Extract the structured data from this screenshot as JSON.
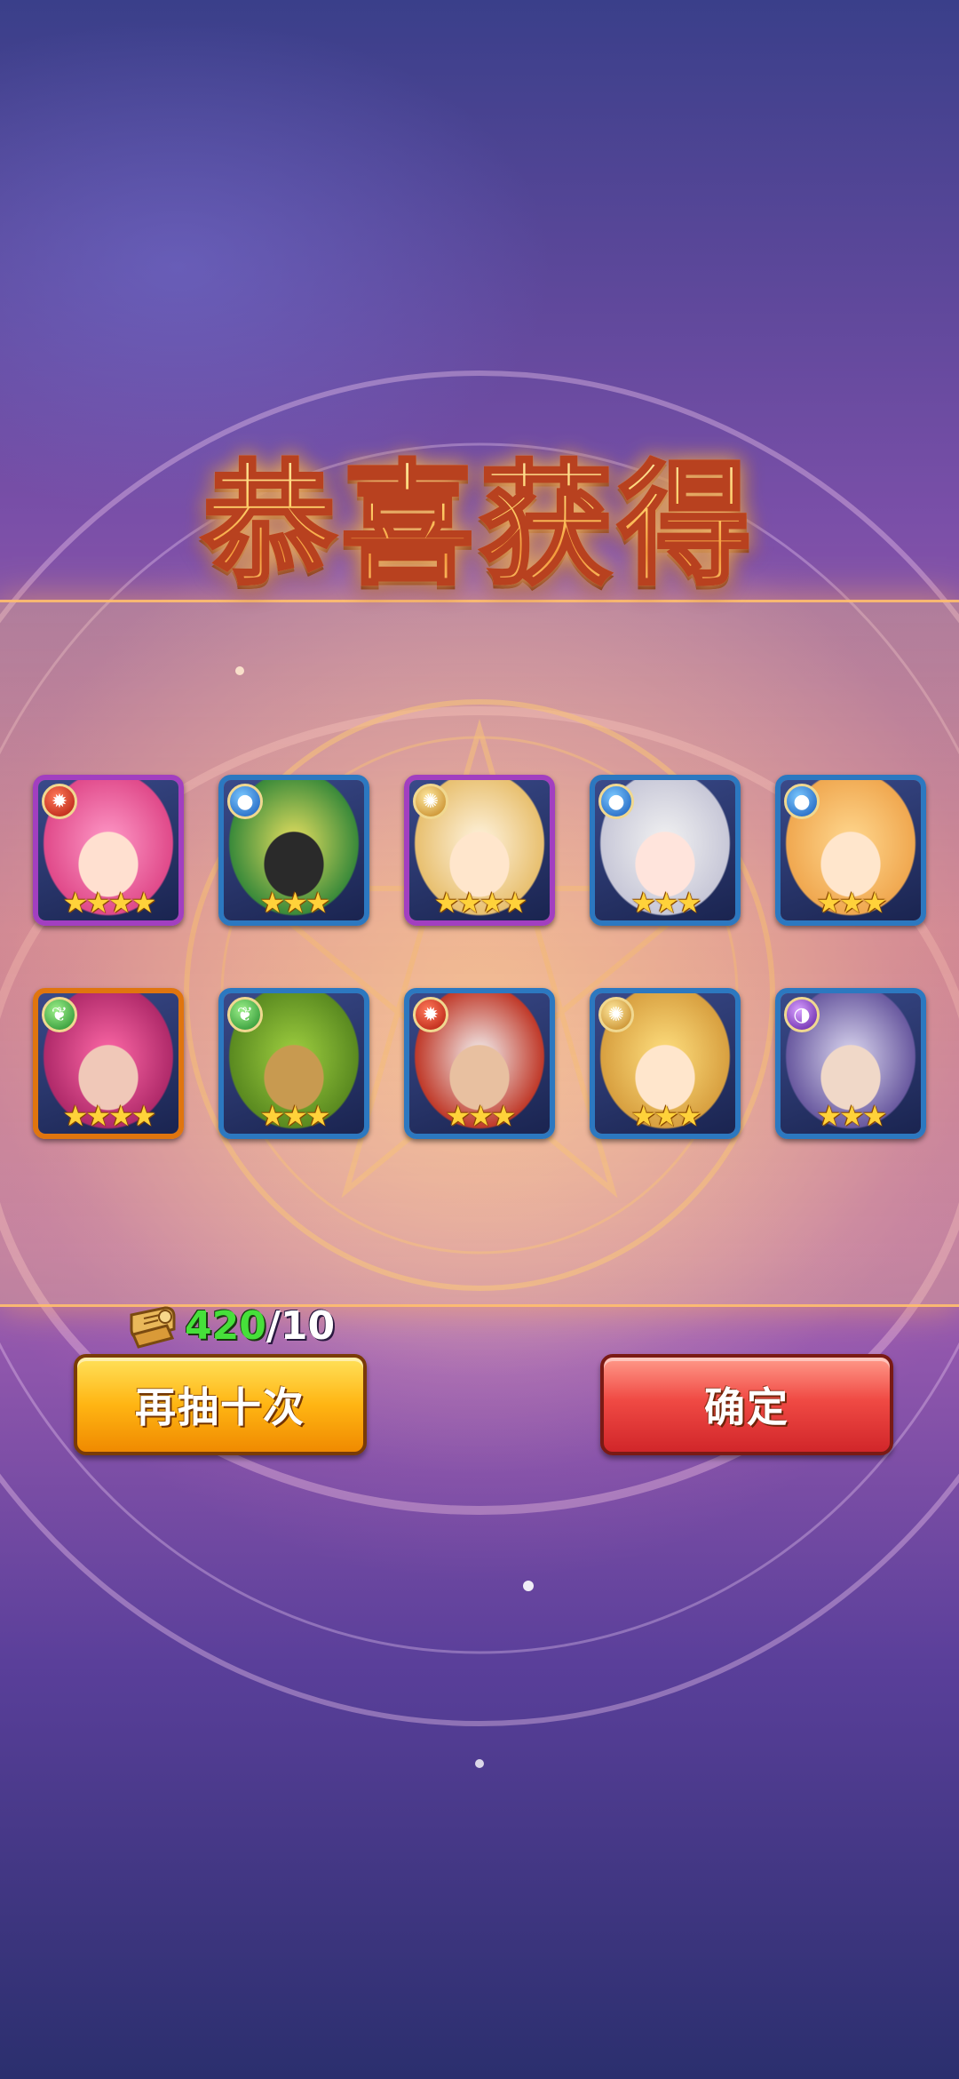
{
  "title": "恭喜获得",
  "rewards": [
    {
      "element": "fire",
      "element_icon": "fire-element-icon",
      "stars": 4,
      "rarity_color": "#a23fc0",
      "portrait": "pink-hair-girl"
    },
    {
      "element": "water",
      "element_icon": "water-element-icon",
      "stars": 3,
      "rarity_color": "#2c78c0",
      "portrait": "gas-mask-character"
    },
    {
      "element": "light",
      "element_icon": "light-element-icon",
      "stars": 4,
      "rarity_color": "#a23fc0",
      "portrait": "white-hood-priestess"
    },
    {
      "element": "water",
      "element_icon": "water-element-icon",
      "stars": 3,
      "rarity_color": "#2c78c0",
      "portrait": "white-hair-girl"
    },
    {
      "element": "water",
      "element_icon": "water-element-icon",
      "stars": 3,
      "rarity_color": "#2c78c0",
      "portrait": "blonde-girl"
    },
    {
      "element": "nature",
      "element_icon": "nature-element-icon",
      "stars": 4,
      "rarity_color": "#e0750e",
      "portrait": "horned-elf"
    },
    {
      "element": "nature",
      "element_icon": "nature-element-icon",
      "stars": 3,
      "rarity_color": "#2c78c0",
      "portrait": "treant"
    },
    {
      "element": "fire",
      "element_icon": "fire-element-icon",
      "stars": 3,
      "rarity_color": "#2c78c0",
      "portrait": "bearded-dwarf"
    },
    {
      "element": "light",
      "element_icon": "light-element-icon",
      "stars": 3,
      "rarity_color": "#2c78c0",
      "portrait": "blonde-knight-girl"
    },
    {
      "element": "dark",
      "element_icon": "dark-element-icon",
      "stars": 3,
      "rarity_color": "#2c78c0",
      "portrait": "silver-hair-man"
    }
  ],
  "currency": {
    "icon": "summon-scroll-icon",
    "have": "420",
    "cost": "/10"
  },
  "buttons": {
    "again": "再抽十次",
    "confirm": "确定"
  }
}
